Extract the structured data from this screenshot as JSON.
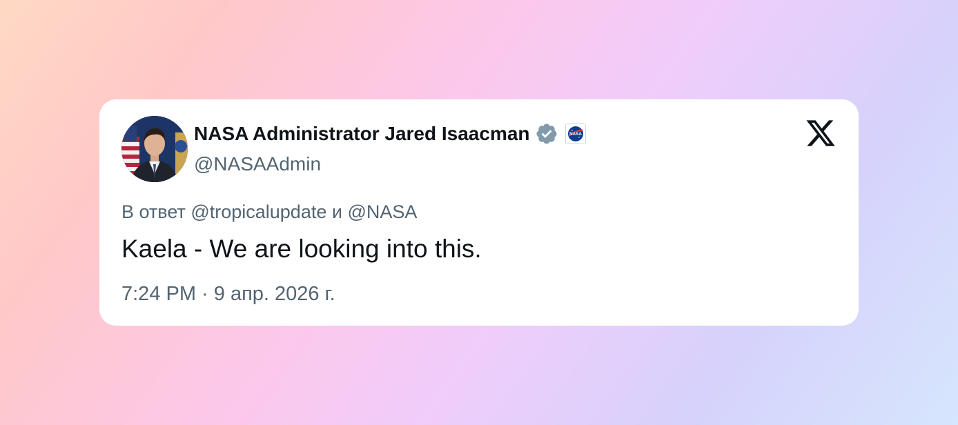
{
  "tweet": {
    "display_name": "NASA Administrator Jared Isaacman",
    "handle": "@NASAAdmin",
    "reply_to": "В ответ @tropicalupdate и @NASA",
    "text": "Kaela - We are looking into this.",
    "timestamp": "7:24 PM · 9 апр. 2026 г."
  },
  "icons": {
    "verified": "verified-badge-icon",
    "affiliate": "nasa-logo-icon",
    "platform": "x-logo-icon"
  },
  "colors": {
    "verified_badge": "#829aab",
    "text_primary": "#0f1419",
    "text_secondary": "#536471",
    "card_background": "#ffffff"
  }
}
